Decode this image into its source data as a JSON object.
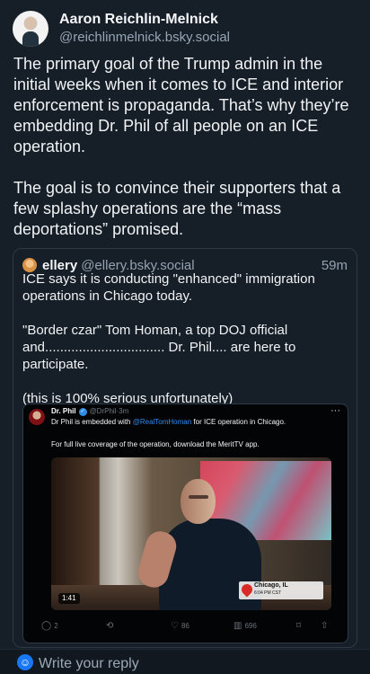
{
  "author": {
    "name": "Aaron Reichlin-Melnick",
    "handle": "@reichlinmelnick.bsky.social"
  },
  "post": {
    "text": "The primary goal of the Trump admin in the initial weeks when it comes to ICE and interior enforcement is propaganda. That’s why they’re embedding Dr. Phil of all people on an ICE operation.\n\nThe goal is to convince their supporters that a few splashy operations are the “mass deportations” promised."
  },
  "quote": {
    "name": "ellery",
    "handle": "@ellery.bsky.social",
    "time": "59m",
    "text": "ICE says it is conducting \"enhanced\" immigration operations in Chicago today.\n\n\"Border czar\" Tom Homan, a top DOJ official and................................ Dr. Phil.... are here to participate.\n\n(this is 100% serious unfortunately)"
  },
  "embed": {
    "name": "Dr. Phil",
    "verified_icon": "verified-badge-icon",
    "handle": "@DrPhil",
    "separator": "·",
    "time": "3m",
    "menu_icon": "more-icon",
    "line1_before": "Dr Phil is embedded with ",
    "mention": "@RealTomHoman",
    "line1_after": " for ICE operation in Chicago.",
    "line2": "For full live coverage of the operation, download the MeritTV app.",
    "video_duration": "1:41",
    "location_city": "Chicago, IL",
    "location_time": "6:04 PM CST",
    "actions": {
      "reply_count": "2",
      "repost_count": "",
      "like_count": "86",
      "views_count": "696"
    }
  },
  "reply_bar": {
    "placeholder": "Write your reply"
  },
  "colors": {
    "background": "#161e27",
    "accent": "#1877f2",
    "mention": "#2c8df1"
  }
}
